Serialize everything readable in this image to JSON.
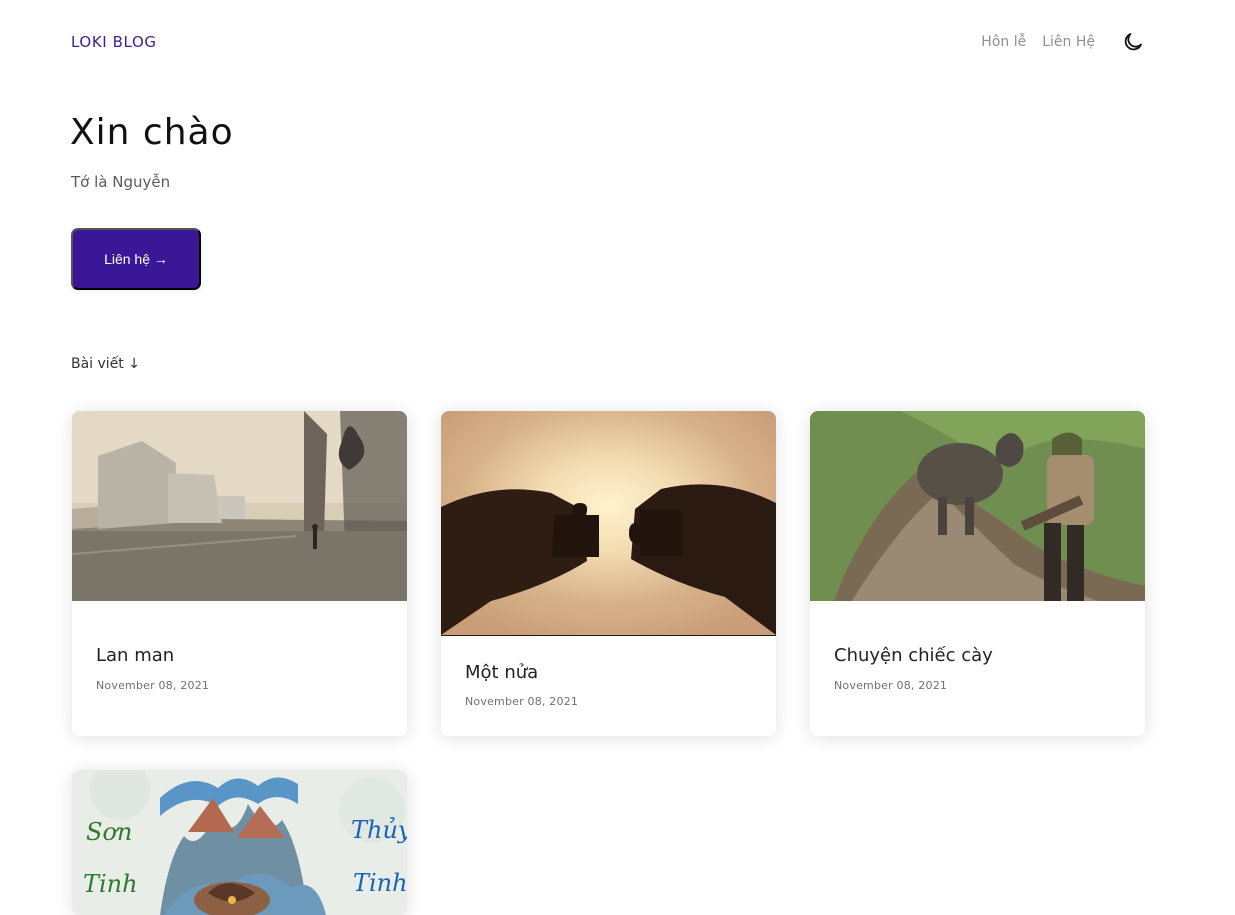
{
  "header": {
    "brand": "LOKI BLOG",
    "nav": [
      {
        "label": "Hôn lễ"
      },
      {
        "label": "Liên Hệ"
      }
    ],
    "theme_icon": "moon-icon"
  },
  "hero": {
    "title": "Xin chào",
    "subtitle": "Tớ là Nguyễn",
    "cta_label": "Liên hệ →"
  },
  "posts_section": {
    "label": "Bài viết ↓"
  },
  "posts": [
    {
      "title": "Lan man",
      "date": "November 08, 2021"
    },
    {
      "title": "Một nửa",
      "date": "November 08, 2021"
    },
    {
      "title": "Chuyện chiếc cày",
      "date": "November 08, 2021"
    },
    {
      "title": "",
      "date": ""
    }
  ],
  "colors": {
    "accent": "#3a1797",
    "brand": "#3b1d9a",
    "muted": "#8f8f98"
  }
}
